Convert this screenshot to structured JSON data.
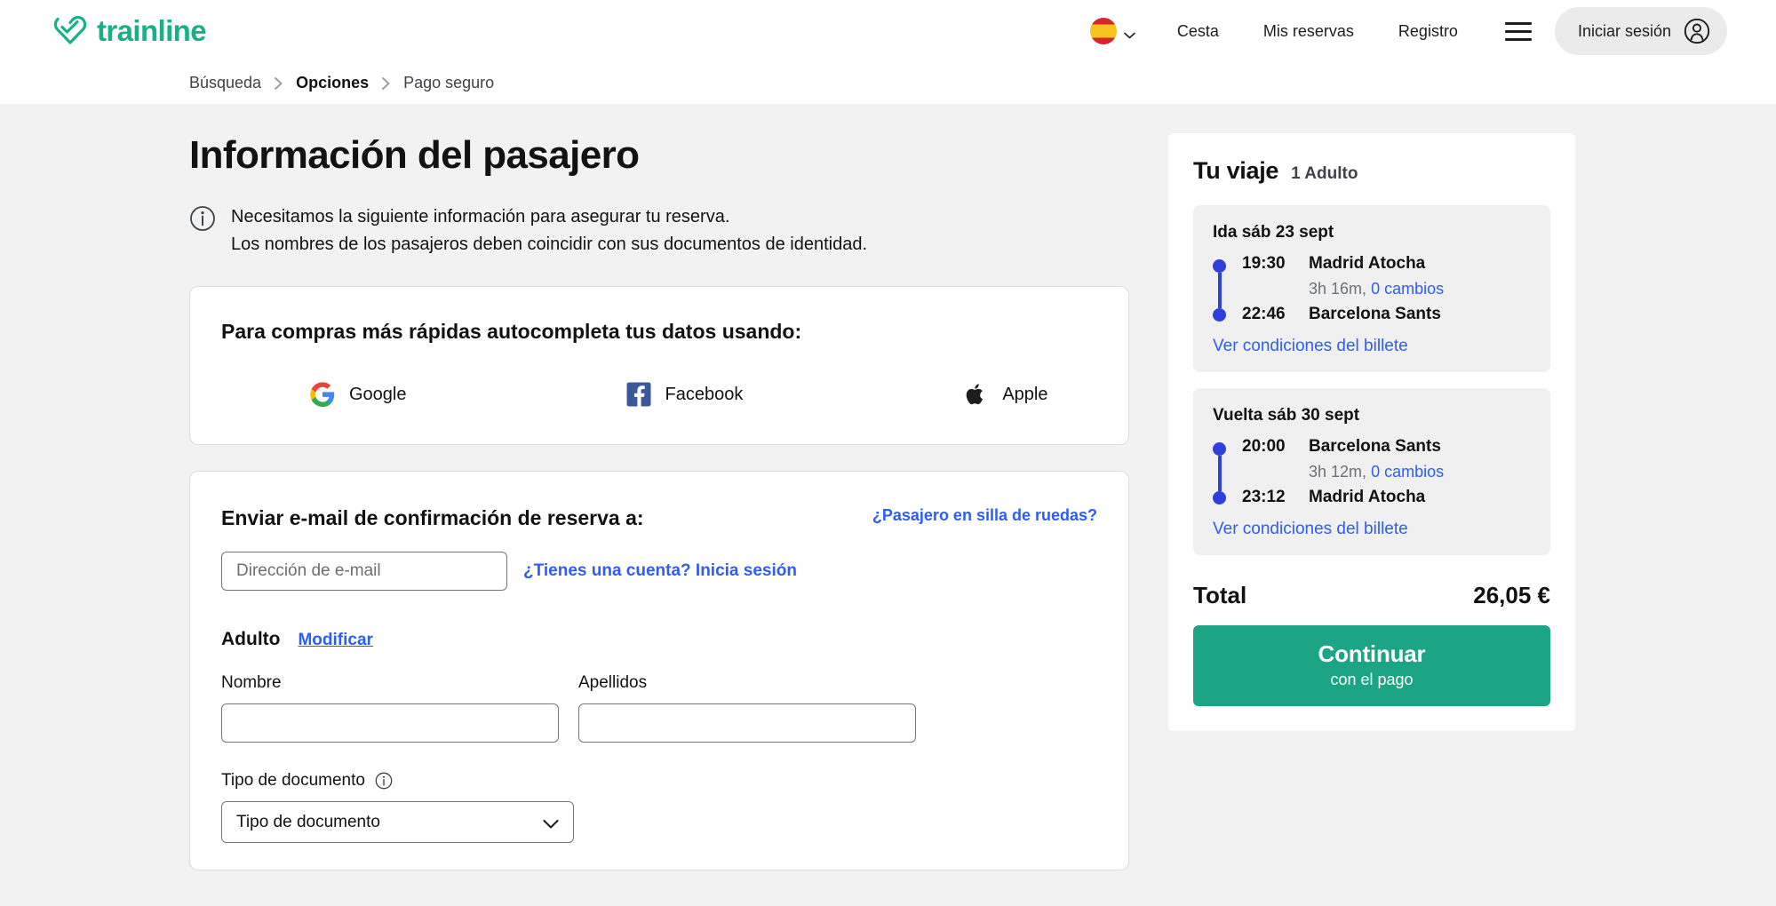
{
  "header": {
    "brand": "trainline",
    "logo_icon": "trainline-heart-logo",
    "language": {
      "icon": "spain-flag-icon",
      "chevron_icon": "chevron-down-icon"
    },
    "nav_links": [
      {
        "label": "Cesta",
        "name": "nav-cesta"
      },
      {
        "label": "Mis reservas",
        "name": "nav-mis-reservas"
      },
      {
        "label": "Registro",
        "name": "nav-registro"
      }
    ],
    "menu_icon": "hamburger-menu-icon",
    "login": {
      "label": "Iniciar sesión",
      "icon": "user-avatar-icon"
    },
    "brand_color": "#1ab087"
  },
  "breadcrumb": {
    "sep_icon": "chevron-right-icon",
    "items": [
      {
        "label": "Búsqueda",
        "current": false
      },
      {
        "label": "Opciones",
        "current": true
      },
      {
        "label": "Pago seguro",
        "current": false
      }
    ]
  },
  "main": {
    "title": "Información del pasajero",
    "info_icon": "info-circle-icon",
    "info_lines": [
      "Necesitamos la siguiente información para asegurar tu reserva.",
      "Los nombres de los pasajeros deben coincidir con sus documentos de identidad."
    ],
    "social": {
      "title": "Para compras más rápidas autocompleta tus datos usando:",
      "providers": [
        {
          "label": "Google",
          "icon": "google-icon"
        },
        {
          "label": "Facebook",
          "icon": "facebook-icon"
        },
        {
          "label": "Apple",
          "icon": "apple-icon"
        }
      ]
    },
    "form": {
      "email_heading": "Enviar e-mail de confirmación de reserva a:",
      "wheelchair_link": "¿Pasajero en silla de ruedas?",
      "email_placeholder": "Dirección de e-mail",
      "email_value": "",
      "account_link": "¿Tienes una cuenta? Inicia sesión",
      "passenger_label": "Adulto",
      "modify_link": "Modificar",
      "first_name_label": "Nombre",
      "first_name_value": "",
      "last_name_label": "Apellidos",
      "last_name_value": "",
      "document_label": "Tipo de documento",
      "document_help_icon": "info-circle-icon",
      "document_selected": "Tipo de documento",
      "document_chevron_icon": "chevron-down-icon"
    }
  },
  "sidebar": {
    "title": "Tu viaje",
    "passengers": "1 Adulto",
    "legs": [
      {
        "date": "Ida sáb 23 sept",
        "depart_time": "19:30",
        "depart_station": "Madrid Atocha",
        "duration": "3h 16m,",
        "changes": "0 cambios",
        "arrive_time": "22:46",
        "arrive_station": "Barcelona Sants",
        "conditions_link": "Ver condiciones del billete"
      },
      {
        "date": "Vuelta sáb 30 sept",
        "depart_time": "20:00",
        "depart_station": "Barcelona Sants",
        "duration": "3h 12m,",
        "changes": "0 cambios",
        "arrive_time": "23:12",
        "arrive_station": "Madrid Atocha",
        "conditions_link": "Ver condiciones del billete"
      }
    ],
    "total_label": "Total",
    "total_value": "26,05 €",
    "continue_main": "Continuar",
    "continue_sub": "con el pago",
    "continue_color": "#1ba585",
    "accent_link_color": "#2f5cf4",
    "rail_color": "#2f3fdc"
  }
}
